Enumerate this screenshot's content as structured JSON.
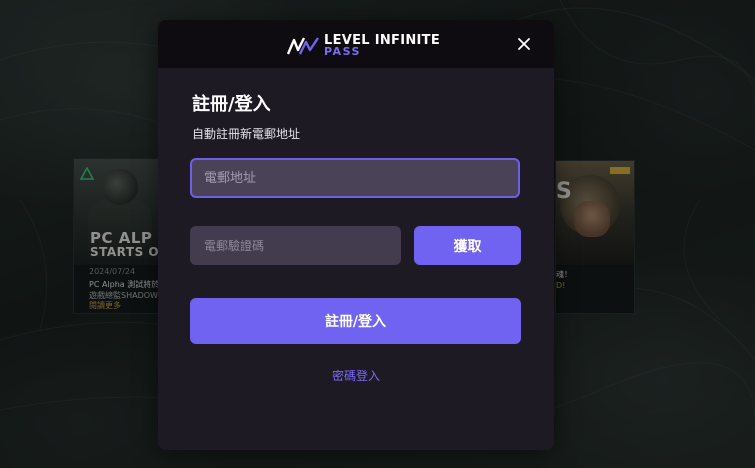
{
  "brand": {
    "line1": "LEVEL INFINITE",
    "line2": "PASS",
    "accent_color": "#7163f1"
  },
  "modal": {
    "title": "註冊/登入",
    "subtitle": "自動註冊新電郵地址",
    "email_placeholder": "電郵地址",
    "code_placeholder": "電郵驗證碼",
    "get_code_label": "獲取",
    "submit_label": "註冊/登入",
    "password_login_link": "密碼登入",
    "close_icon": "close-icon"
  },
  "background": {
    "left_card": {
      "image_text_1": "PC ALP",
      "image_text_2": "STARTS O",
      "date": "2024/07/24",
      "title": "PC Alpha 測試將於",
      "subtitle": "遊戲總監SHADOW",
      "more": "閱讀更多"
    },
    "right_card": {
      "big_text": "S",
      "title": "魂！",
      "more": "D!"
    }
  }
}
